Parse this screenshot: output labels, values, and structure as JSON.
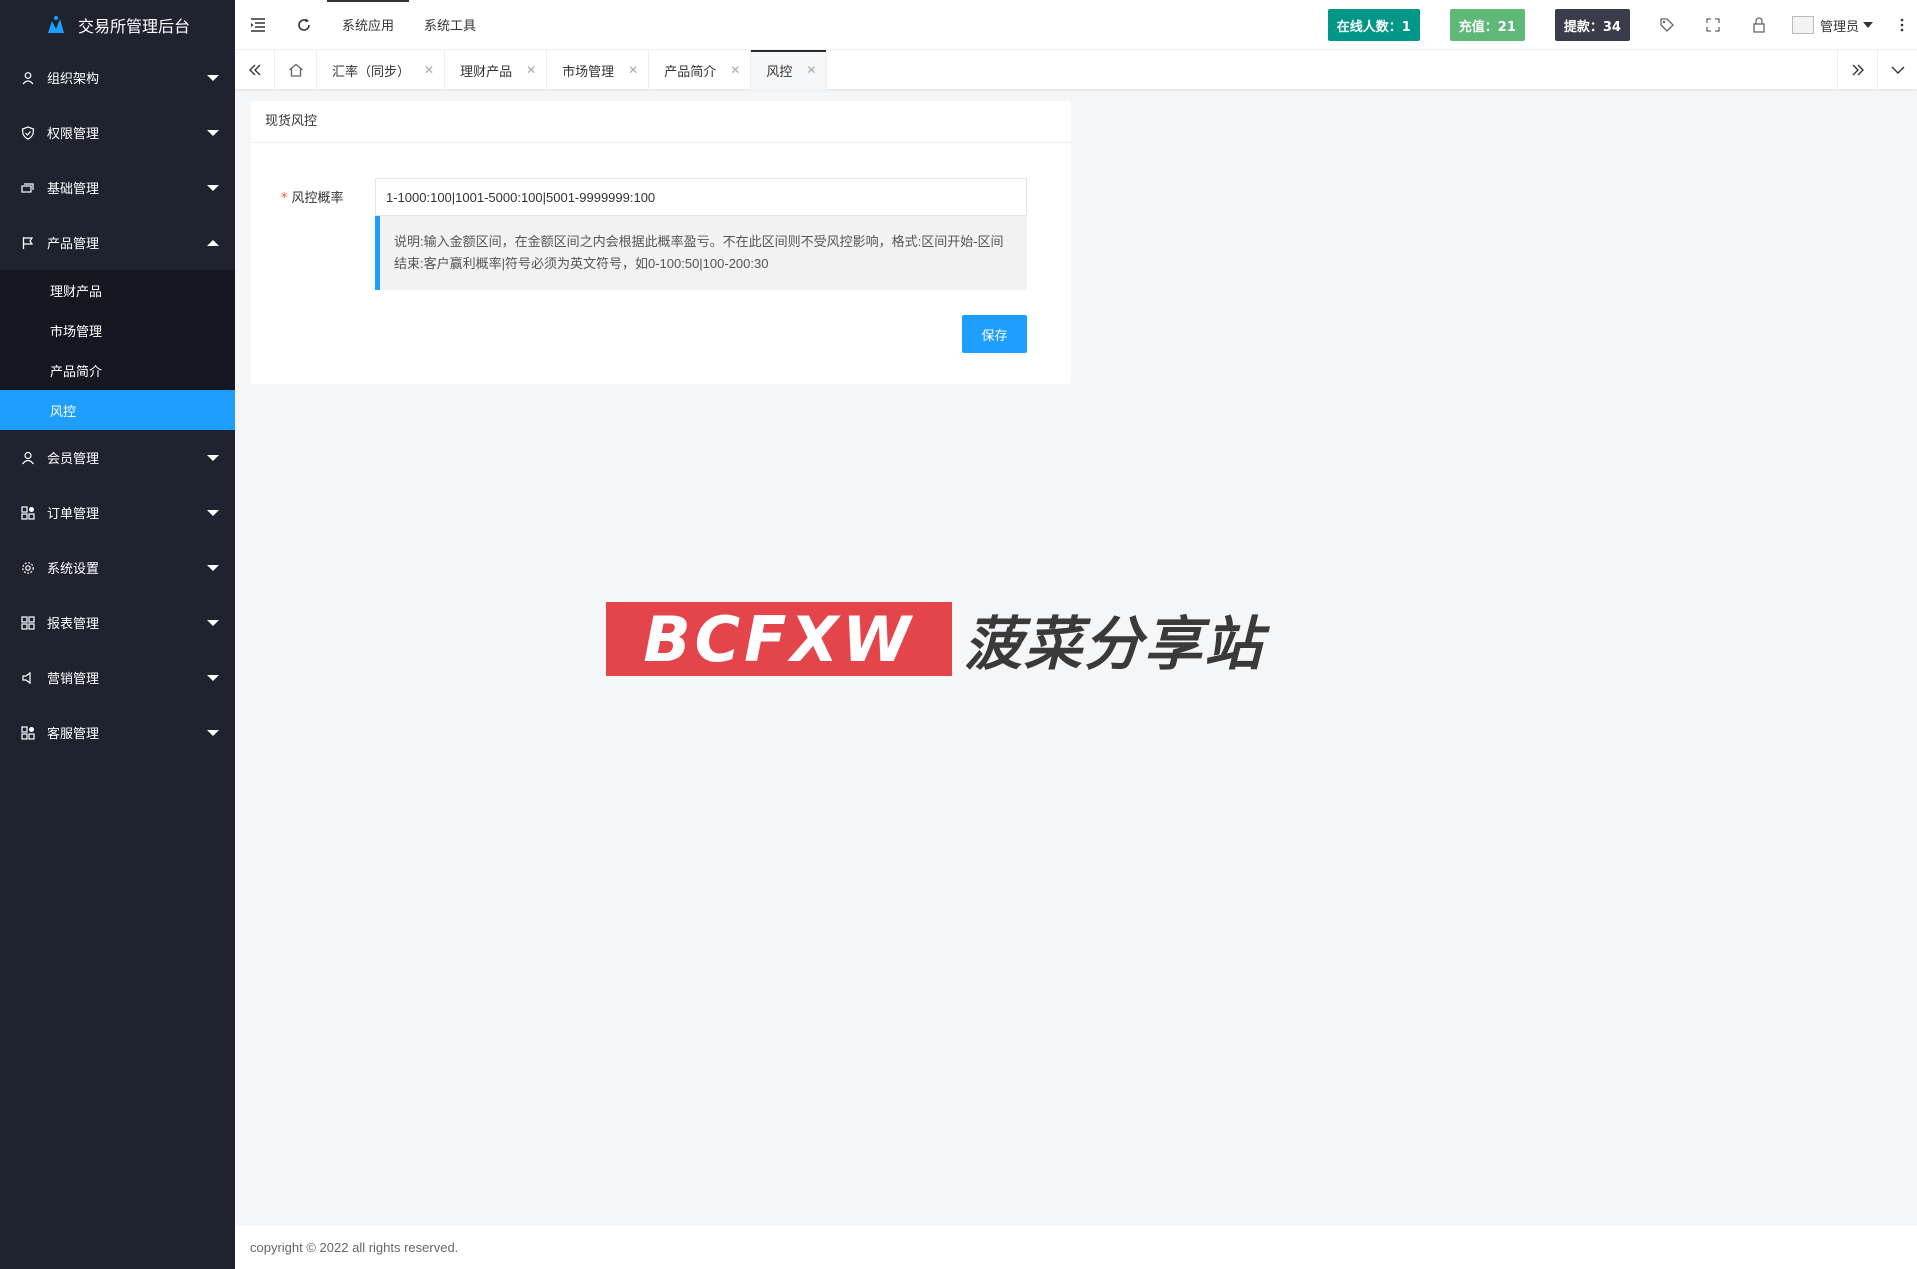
{
  "app": {
    "title": "交易所管理后台"
  },
  "sidebar": {
    "items": [
      {
        "label": "组织架构",
        "icon": "user-group-icon"
      },
      {
        "label": "权限管理",
        "icon": "shield-icon"
      },
      {
        "label": "基础管理",
        "icon": "stack-icon"
      },
      {
        "label": "产品管理",
        "icon": "flag-icon",
        "expanded": true
      },
      {
        "label": "会员管理",
        "icon": "user-icon"
      },
      {
        "label": "订单管理",
        "icon": "apps-icon"
      },
      {
        "label": "系统设置",
        "icon": "gear-icon"
      },
      {
        "label": "报表管理",
        "icon": "grid-icon"
      },
      {
        "label": "营销管理",
        "icon": "speaker-icon"
      },
      {
        "label": "客服管理",
        "icon": "apps-icon"
      }
    ],
    "product_sub": [
      {
        "label": "理财产品"
      },
      {
        "label": "市场管理"
      },
      {
        "label": "产品简介"
      },
      {
        "label": "风控",
        "active": true
      }
    ]
  },
  "header": {
    "links": [
      "系统应用",
      "系统工具"
    ],
    "online_badge": "在线人数：1",
    "recharge_badge": "充值：21",
    "withdraw_badge": "提款：34",
    "badge_colors": {
      "online": "#009688",
      "recharge": "#5fb878",
      "withdraw": "#393d49"
    },
    "user": "管理员"
  },
  "tabs": [
    {
      "label": "汇率（同步）"
    },
    {
      "label": "理财产品"
    },
    {
      "label": "市场管理"
    },
    {
      "label": "产品简介"
    },
    {
      "label": "风控",
      "active": true
    }
  ],
  "card": {
    "title": "现货风控",
    "field_label": "风控概率",
    "field_value": "1-1000:100|1001-5000:100|5001-9999999:100",
    "tip": "说明:输入金额区间，在金额区间之内会根据此概率盈亏。不在此区间则不受风控影响，格式:区间开始-区间结束:客户赢利概率|符号必须为英文符号，如0-100:50|100-200:30",
    "save_label": "保存"
  },
  "watermark": {
    "logo_text": "BCFXW",
    "text": "菠菜分享站"
  },
  "footer": {
    "copyright": "copyright © 2022 all rights reserved."
  },
  "colors": {
    "accent": "#1e9fff",
    "sidebar_bg": "#1f2330"
  }
}
